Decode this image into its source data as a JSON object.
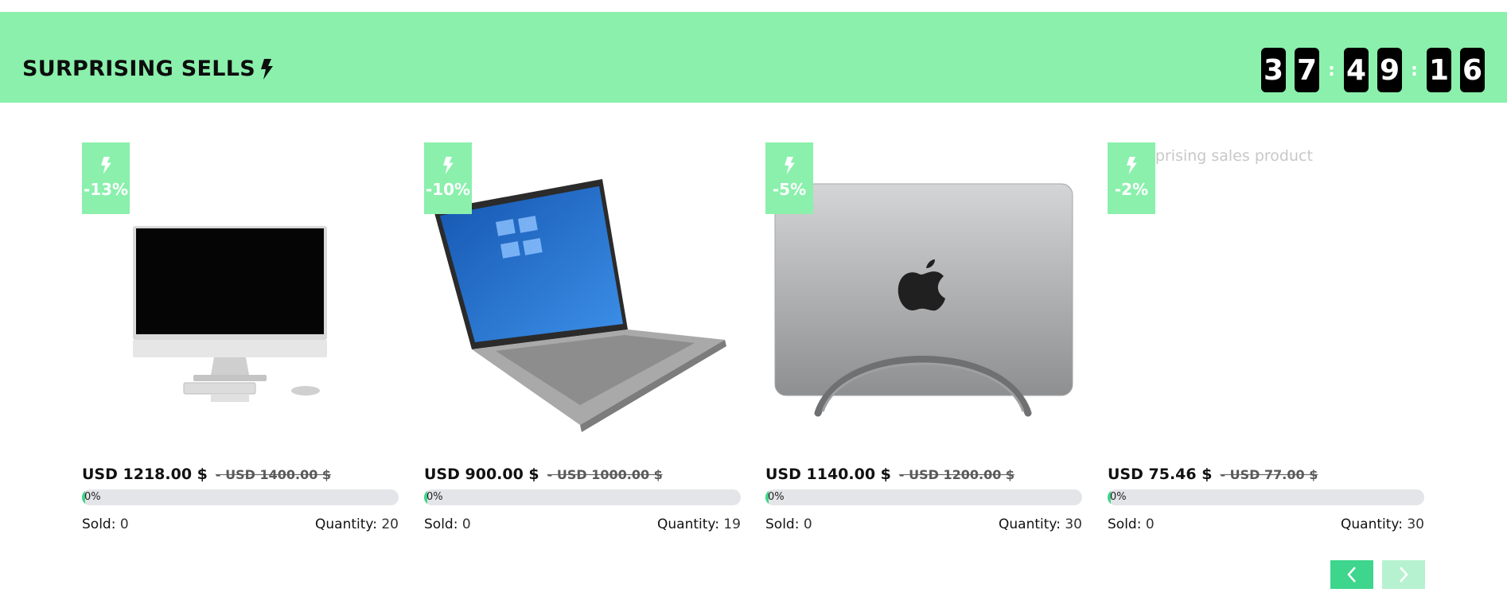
{
  "header": {
    "title": "SURPRISING SELLS",
    "title_icon": "lightning-icon",
    "countdown": {
      "hours": [
        "3",
        "7"
      ],
      "minutes": [
        "4",
        "9"
      ],
      "seconds": [
        "1",
        "6"
      ],
      "separator": ":"
    }
  },
  "labels": {
    "sold": "Sold:",
    "quantity": "Quantity:"
  },
  "colors": {
    "accent": "#8af0ac",
    "button": "#3dd68c",
    "button_disabled": "#b6f2d0",
    "progress_track": "#e4e5e8"
  },
  "products": [
    {
      "discount": "-13%",
      "price": "USD 1218.00 $",
      "old_price": "- USD 1400.00 $",
      "progress": "0%",
      "sold": "0",
      "quantity": "20",
      "image": "imac-desktop-image"
    },
    {
      "discount": "-10%",
      "price": "USD 900.00 $",
      "old_price": "- USD 1000.00 $",
      "progress": "0%",
      "sold": "0",
      "quantity": "19",
      "image": "laptop-image"
    },
    {
      "discount": "-5%",
      "price": "USD 1140.00 $",
      "old_price": "- USD 1200.00 $",
      "progress": "0%",
      "sold": "0",
      "quantity": "30",
      "image": "macbook-stand-image"
    },
    {
      "discount": "-2%",
      "price": "USD 75.46 $",
      "old_price": "- USD 77.00 $",
      "progress": "0%",
      "sold": "0",
      "quantity": "30",
      "image_alt": "Surprising sales product"
    }
  ],
  "pagination": {
    "prev_icon": "chevron-left-icon",
    "next_icon": "chevron-right-icon"
  }
}
